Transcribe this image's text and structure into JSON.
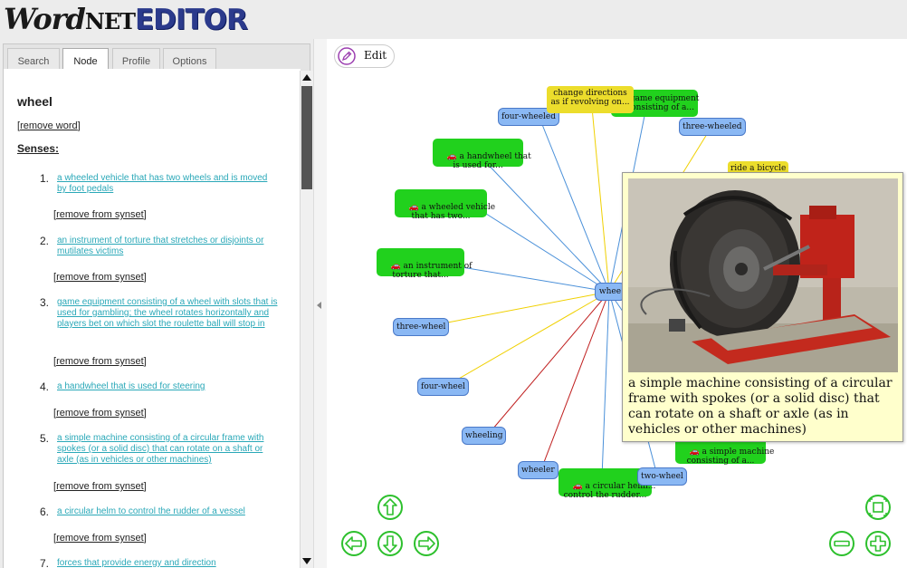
{
  "app": {
    "logo_part1": "Word",
    "logo_part2": "NET",
    "logo_part3": "EDITOR"
  },
  "tabs": [
    {
      "label": "Search",
      "active": false
    },
    {
      "label": "Node",
      "active": true
    },
    {
      "label": "Profile",
      "active": false
    },
    {
      "label": "Options",
      "active": false
    }
  ],
  "node_panel": {
    "word": "wheel",
    "remove_word": "remove word",
    "senses_heading": "Senses:",
    "remove_synset": "remove from synset",
    "senses": [
      {
        "num": "1.",
        "def": "a wheeled vehicle that has two wheels and is moved by foot pedals"
      },
      {
        "num": "2.",
        "def": "an instrument of torture that stretches or disjoints or mutilates victims"
      },
      {
        "num": "3.",
        "def": "game equipment consisting of a wheel with slots that is used for gambling; the wheel rotates horizontally and players bet on which slot the roulette ball will stop in"
      },
      {
        "num": "4.",
        "def": "a handwheel that is used for steering"
      },
      {
        "num": "5.",
        "def": "a simple machine consisting of a circular frame with spokes (or a solid disc) that can rotate on a shaft or axle (as in vehicles or other machines)"
      },
      {
        "num": "6.",
        "def": "a circular helm to control the rudder of a vessel"
      },
      {
        "num": "7.",
        "def": "forces that provide energy and direction"
      }
    ]
  },
  "graph": {
    "edit_label": "Edit",
    "center_label": "whee",
    "nodes": [
      {
        "id": "n1",
        "label": "four-wheeled",
        "color": "blue"
      },
      {
        "id": "n2",
        "label": "change directions\nas if revolving on...",
        "color": "yellow"
      },
      {
        "id": "n3",
        "label": "game equipment\nconsisting of a...",
        "color": "green",
        "prefix": "me"
      },
      {
        "id": "n4",
        "label": "three-wheeled",
        "color": "blue"
      },
      {
        "id": "n5",
        "label": "a handwheel that\nis used for...",
        "color": "green"
      },
      {
        "id": "n6",
        "label": "ride a bicycle",
        "color": "yellow"
      },
      {
        "id": "n7",
        "label": "a wheeled vehicle\nthat has two...",
        "color": "green"
      },
      {
        "id": "n8",
        "label": "an instrument of\ntorture that...",
        "color": "green"
      },
      {
        "id": "n9",
        "label": "three-wheel",
        "color": "blue"
      },
      {
        "id": "n10",
        "label": "four-wheel",
        "color": "blue"
      },
      {
        "id": "n11",
        "label": "wheeling",
        "color": "blue"
      },
      {
        "id": "n12",
        "label": "wheeler",
        "color": "blue"
      },
      {
        "id": "n13",
        "label": "a circular helm...\ncontrol the rudder...",
        "color": "green"
      },
      {
        "id": "n14",
        "label": "two-wheel",
        "color": "blue"
      },
      {
        "id": "n15",
        "label": "a simple machine\nconsisting of a...",
        "color": "green"
      }
    ],
    "tooltip_text": "a simple machine consisting of a circular frame with spokes (or a solid disc) that can rotate on a shaft or axle (as in vehicles or other machines)"
  },
  "colors": {
    "blue_node": "#8ab8f4",
    "green_node": "#21d11d",
    "yellow_node": "#ecdd2c",
    "link": "#2aa8b8",
    "nav_green": "#2dc02d"
  },
  "icons": [
    "pencil-icon",
    "arrow-up-icon",
    "arrow-left-icon",
    "arrow-down-icon",
    "arrow-right-icon",
    "fit-screen-icon",
    "zoom-out-icon",
    "zoom-in-icon"
  ]
}
